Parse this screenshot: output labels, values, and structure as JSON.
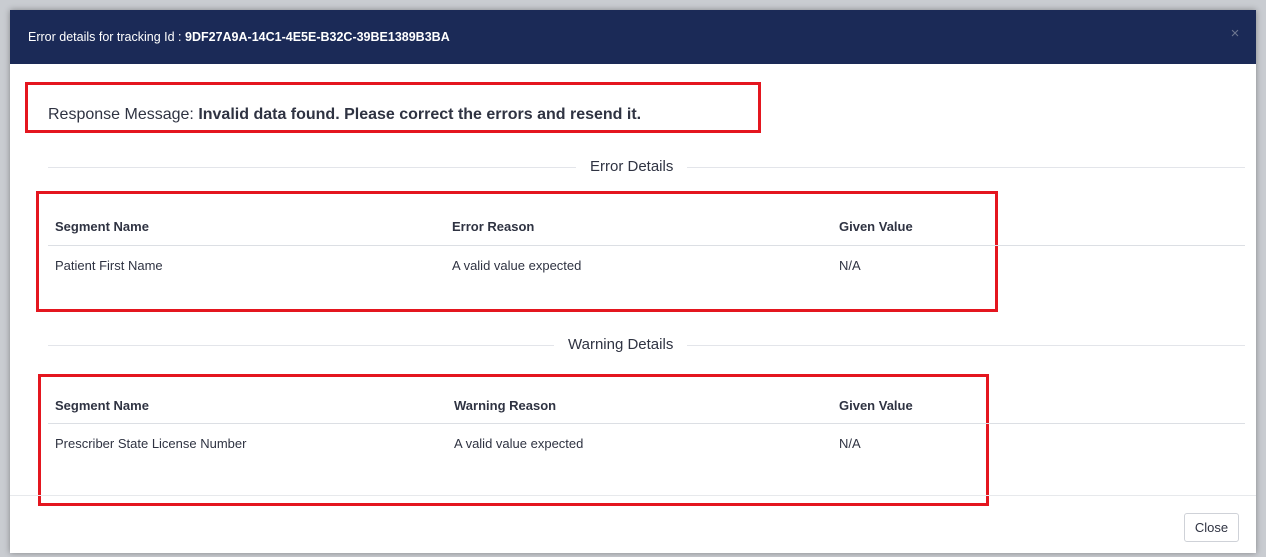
{
  "modal": {
    "title_prefix": "Error details for tracking Id : ",
    "tracking_id": "9DF27A9A-14C1-4E5E-B32C-39BE1389B3BA",
    "close_icon": "×",
    "response_label": "Response Message: ",
    "response_message": "Invalid data found. Please correct the errors and resend it.",
    "close_button_label": "Close"
  },
  "error_details": {
    "title": "Error Details",
    "columns": [
      "Segment Name",
      "Error Reason",
      "Given Value"
    ],
    "rows": [
      [
        "Patient First Name",
        "A valid value expected",
        "N/A"
      ]
    ]
  },
  "warning_details": {
    "title": "Warning Details",
    "columns": [
      "Segment Name",
      "Warning Reason",
      "Given Value"
    ],
    "rows": [
      [
        "Prescriber State License Number",
        "A valid value expected",
        "N/A"
      ]
    ]
  },
  "colors": {
    "header_bg": "#1b2a57",
    "highlight_border": "#e4161f"
  }
}
